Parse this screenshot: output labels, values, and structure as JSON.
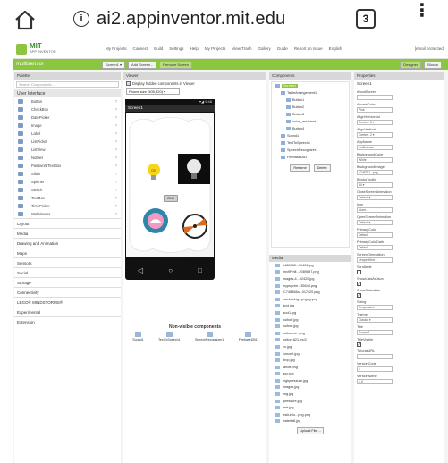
{
  "browser": {
    "url": "ai2.appinventor.mit.edu",
    "tab_count": "3"
  },
  "logo": {
    "line1": "MIT",
    "line2": "APP INVENTOR"
  },
  "topnav": {
    "items": [
      "My Projects",
      "Connect",
      "Build",
      "Settings",
      "Help",
      "My Projects",
      "View Trash",
      "Gallery",
      "Guide",
      "Report an Issue",
      "English"
    ],
    "email": "[email protected]"
  },
  "projbar": {
    "project_name": "multisensor",
    "screen_button": "Screen1 ▾",
    "add_screen": "Add Screen...",
    "remove_screen": "Remove Screen",
    "designer": "Designer",
    "blocks": "Blocks"
  },
  "palette": {
    "title": "Palette",
    "search_placeholder": "Search Components...",
    "section": "User Interface",
    "items": [
      "Button",
      "CheckBox",
      "DatePicker",
      "Image",
      "Label",
      "ListPicker",
      "ListView",
      "Notifier",
      "PasswordTextBox",
      "Slider",
      "Spinner",
      "Switch",
      "TextBox",
      "TimePicker",
      "WebViewer"
    ],
    "categories": [
      "Layout",
      "Media",
      "Drawing and Animation",
      "Maps",
      "Sensors",
      "Social",
      "Storage",
      "Connectivity",
      "LEGO® MINDSTORMS®",
      "Experimental",
      "Extension"
    ]
  },
  "viewer": {
    "title": "Viewer",
    "display_hidden": "Display hidden components in Viewer",
    "phone_size": "Phone size (505,320) ▾",
    "status_text": "▾◢ 9:48",
    "screen_title": "Screen1",
    "nonvisible_title": "Non-visible components",
    "nonvisible": [
      "Sound1",
      "TextToSpeech1",
      "SpeechRecognizer1",
      "FirebaseDB1"
    ],
    "screen_button_text": "ON!!"
  },
  "components": {
    "title": "Components",
    "tree": [
      "Screen1",
      "TableArrangement1",
      "Button1",
      "Button2",
      "Button3",
      "voice_assistant",
      "Button4",
      "Sound1",
      "TextToSpeech1",
      "SpeechRecognizer1",
      "FirebaseDB1"
    ],
    "rename": "Rename",
    "delete": "Delete"
  },
  "media": {
    "title": "Media",
    "files": [
      "1488438...39406.jpg",
      "jmx9Fmfl...2089697.png",
      "images-4...92420.jpg",
      "mypsyche...35648.png",
      "IC748858a...017x20.png",
      "Lamba-Lig...pngeg.png",
      "acct.jpg",
      "acct1.jpg",
      "bulboff.jpg",
      "bulbon.jpg",
      "bulbon-ic...png",
      "button-621.mp3",
      "cn.jpg",
      "concert.jpg",
      "drop.jpg",
      "fanoff.png",
      "gun.jpg",
      "highpressure.jpg",
      "images.jpg",
      "img.jpg",
      "lpressure.jpg",
      "mnt.jpg",
      "wall-e-lo...png.png",
      "waterfall.jpg"
    ],
    "upload": "Upload File ..."
  },
  "properties": {
    "title": "Properties",
    "screen_name": "Screen1",
    "items": [
      {
        "label": "AboutScreen",
        "value": ""
      },
      {
        "label": "AccentColor",
        "value": "Pink"
      },
      {
        "label": "AlignHorizontal",
        "value": "Center : 3 ▾"
      },
      {
        "label": "AlignVertical",
        "value": "Center : 2 ▾"
      },
      {
        "label": "AppName",
        "value": "multisensor"
      },
      {
        "label": "BackgroundColor",
        "value": "White"
      },
      {
        "label": "BackgroundImage",
        "value": "b7d87b1...png"
      },
      {
        "label": "BlocksToolkit",
        "value": "All ▾"
      },
      {
        "label": "CloseScreenAnimation",
        "value": "Default ▾"
      },
      {
        "label": "Icon",
        "value": "None..."
      },
      {
        "label": "OpenScreenAnimation",
        "value": "Default ▾"
      },
      {
        "label": "PrimaryColor",
        "value": "Default"
      },
      {
        "label": "PrimaryColorDark",
        "value": "Default"
      },
      {
        "label": "ScreenOrientation",
        "value": "Unspecified ▾"
      },
      {
        "label": "Scrollable",
        "value": ""
      },
      {
        "label": "ShowListsAsJson",
        "value": ""
      },
      {
        "label": "ShowStatusBar",
        "value": ""
      },
      {
        "label": "Sizing",
        "value": "Responsive ▾"
      },
      {
        "label": "Theme",
        "value": "Classic ▾"
      },
      {
        "label": "Title",
        "value": "Screen1"
      },
      {
        "label": "TitleVisible",
        "value": ""
      },
      {
        "label": "TutorialURL",
        "value": ""
      },
      {
        "label": "VersionCode",
        "value": "1"
      },
      {
        "label": "VersionName",
        "value": "1.0"
      }
    ]
  }
}
